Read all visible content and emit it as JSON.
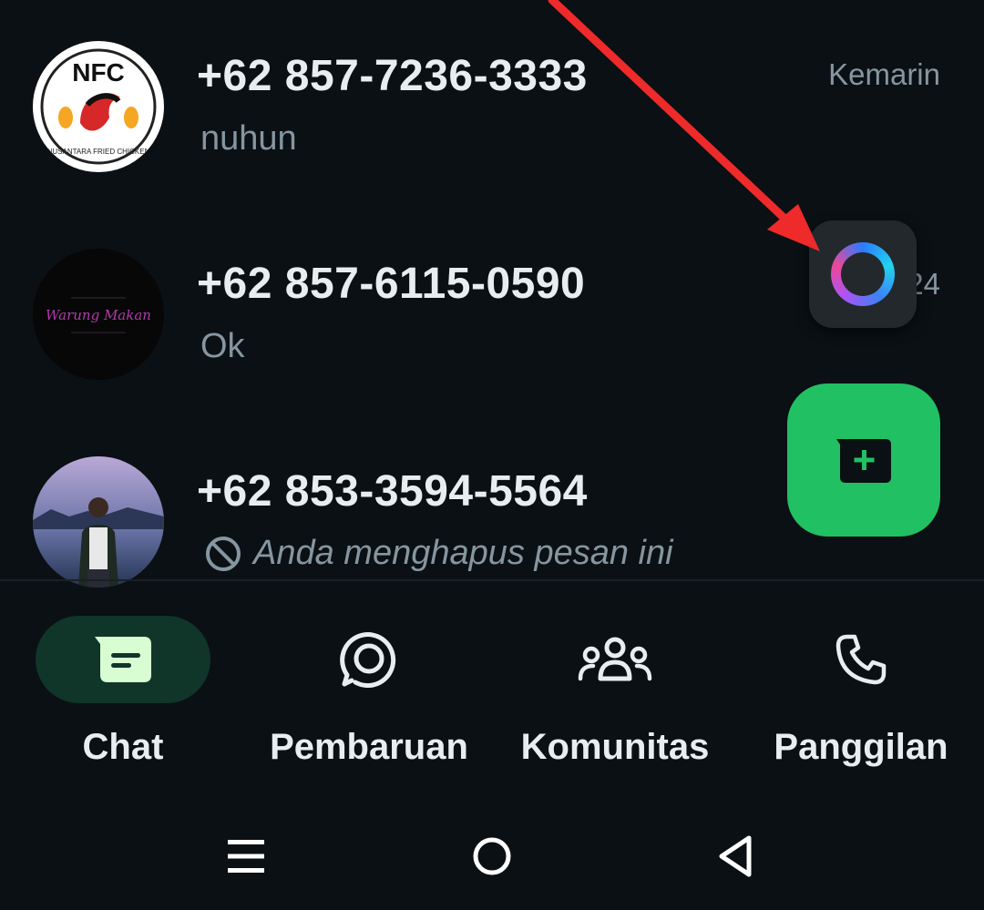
{
  "chats": [
    {
      "name": "+62 857-7236-3333",
      "preview": "nuhun",
      "time": "Kemarin",
      "avatar_text": "NFC",
      "avatar_subtext": "NUSANTARA FRIED CHICKEN"
    },
    {
      "name": "+62 857-6115-0590",
      "preview": "Ok",
      "time": "24",
      "avatar_text": "Warung Makan"
    },
    {
      "name": "+62 853-3594-5564",
      "preview": "Anda menghapus pesan ini",
      "time": ""
    }
  ],
  "nav": {
    "items": [
      {
        "label": "Chat",
        "icon": "chat-icon",
        "active": true
      },
      {
        "label": "Pembaruan",
        "icon": "updates-icon",
        "active": false
      },
      {
        "label": "Komunitas",
        "icon": "communities-icon",
        "active": false
      },
      {
        "label": "Panggilan",
        "icon": "phone-icon",
        "active": false
      }
    ]
  },
  "fab": {
    "icon": "new-chat-icon"
  },
  "assistant": {
    "icon": "meta-ai-ring-icon"
  },
  "colors": {
    "background": "#0b1014",
    "accent": "#21c063",
    "active_pill": "#103529",
    "muted_text": "#8696a0",
    "annotation_arrow": "#ee2a2a"
  }
}
